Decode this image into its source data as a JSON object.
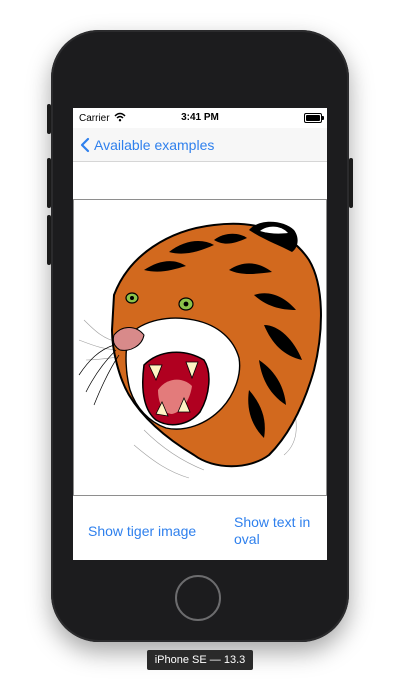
{
  "status_bar": {
    "carrier": "Carrier",
    "time": "3:41 PM",
    "wifi_icon": "wifi-icon",
    "battery_icon": "battery-icon"
  },
  "nav": {
    "back_label": "Available examples",
    "back_icon": "chevron-left-icon"
  },
  "image": {
    "subject": "tiger-image"
  },
  "actions": {
    "show_tiger": "Show tiger image",
    "show_text_oval": "Show text in oval"
  },
  "device": {
    "label": "iPhone SE — 13.3"
  },
  "colors": {
    "accent": "#2F80ED",
    "tiger_orange": "#D2691E",
    "eye_green": "#8BC34A"
  }
}
